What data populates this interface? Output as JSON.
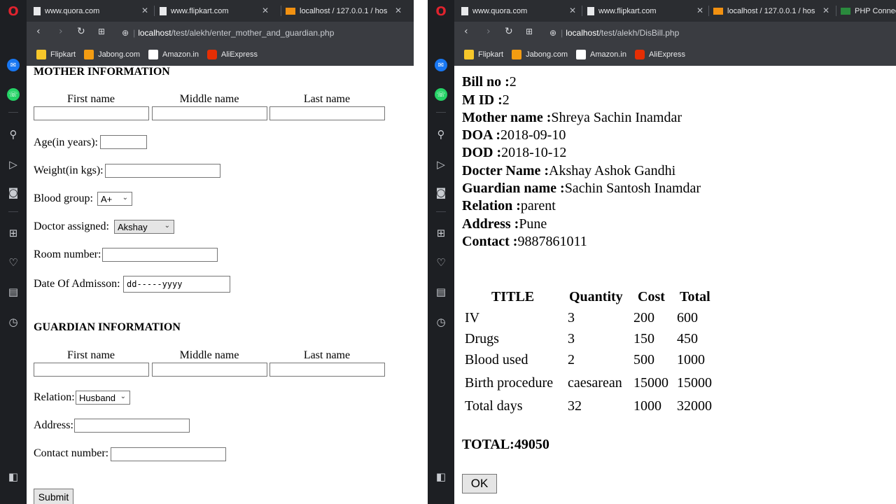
{
  "left_window": {
    "tabs": [
      {
        "label": "www.quora.com"
      },
      {
        "label": "www.flipkart.com"
      },
      {
        "label": "localhost / 127.0.0.1 / hos"
      }
    ],
    "url": {
      "host": "localhost",
      "path": "/test/alekh/enter_mother_and_guardian.php"
    },
    "bookmarks": [
      "Flipkart",
      "Jabong.com",
      "Amazon.in",
      "AliExpress"
    ],
    "form": {
      "mother_heading": "MOTHER INFORMATION",
      "name_labels": [
        "First name",
        "Middle name",
        "Last name"
      ],
      "age_label": "Age(in years):",
      "weight_label": "Weight(in kgs):",
      "blood_label": "Blood group:",
      "blood_value": "A+",
      "doctor_label": "Doctor assigned:",
      "doctor_value": "Akshay",
      "room_label": "Room number:",
      "admission_label": "Date Of Admisson:",
      "admission_placeholder": "dd-----yyyy",
      "guardian_heading": "GUARDIAN INFORMATION",
      "guardian_name_labels": [
        "First name",
        "Middle name",
        "Last name"
      ],
      "relation_label": "Relation:",
      "relation_value": "Husband",
      "address_label": "Address:",
      "contact_label": "Contact number:",
      "submit_label": "Submit"
    }
  },
  "right_window": {
    "tabs": [
      {
        "label": "www.quora.com"
      },
      {
        "label": "www.flipkart.com"
      },
      {
        "label": "localhost / 127.0.0.1 / hos"
      },
      {
        "label": "PHP Connect"
      }
    ],
    "url": {
      "host": "localhost",
      "path": "/test/alekh/DisBill.php"
    },
    "bookmarks": [
      "Flipkart",
      "Jabong.com",
      "Amazon.in",
      "AliExpress"
    ],
    "bill": {
      "fields": [
        {
          "label": "Bill no :",
          "value": "2"
        },
        {
          "label": "M ID :",
          "value": "2"
        },
        {
          "label": "Mother name :",
          "value": "Shreya Sachin Inamdar"
        },
        {
          "label": "DOA :",
          "value": "2018-09-10"
        },
        {
          "label": "DOD :",
          "value": "2018-10-12"
        },
        {
          "label": "Docter Name :",
          "value": "Akshay Ashok Gandhi"
        },
        {
          "label": "Guardian name :",
          "value": "Sachin Santosh Inamdar"
        },
        {
          "label": "Relation :",
          "value": "parent"
        },
        {
          "label": "Address :",
          "value": "Pune"
        },
        {
          "label": "Contact :",
          "value": "9887861011"
        }
      ],
      "table": {
        "headers": [
          "TITLE",
          "Quantity",
          "Cost",
          "Total"
        ],
        "rows": [
          [
            "IV",
            "3",
            "200",
            "600"
          ],
          [
            "Drugs",
            "3",
            "150",
            "450"
          ],
          [
            "Blood used",
            "2",
            "500",
            "1000"
          ],
          [
            "Birth procedure",
            "caesarean",
            "15000",
            "15000"
          ],
          [
            "Total days",
            "32",
            "1000",
            "32000"
          ]
        ]
      },
      "total_text": "TOTAL:49050",
      "ok_label": "OK"
    }
  },
  "colors": {
    "sidebar": "#1d1f23",
    "tabbar": "#2b2d31",
    "toolbar": "#3a3c41",
    "opera_red": "#e0232e"
  }
}
